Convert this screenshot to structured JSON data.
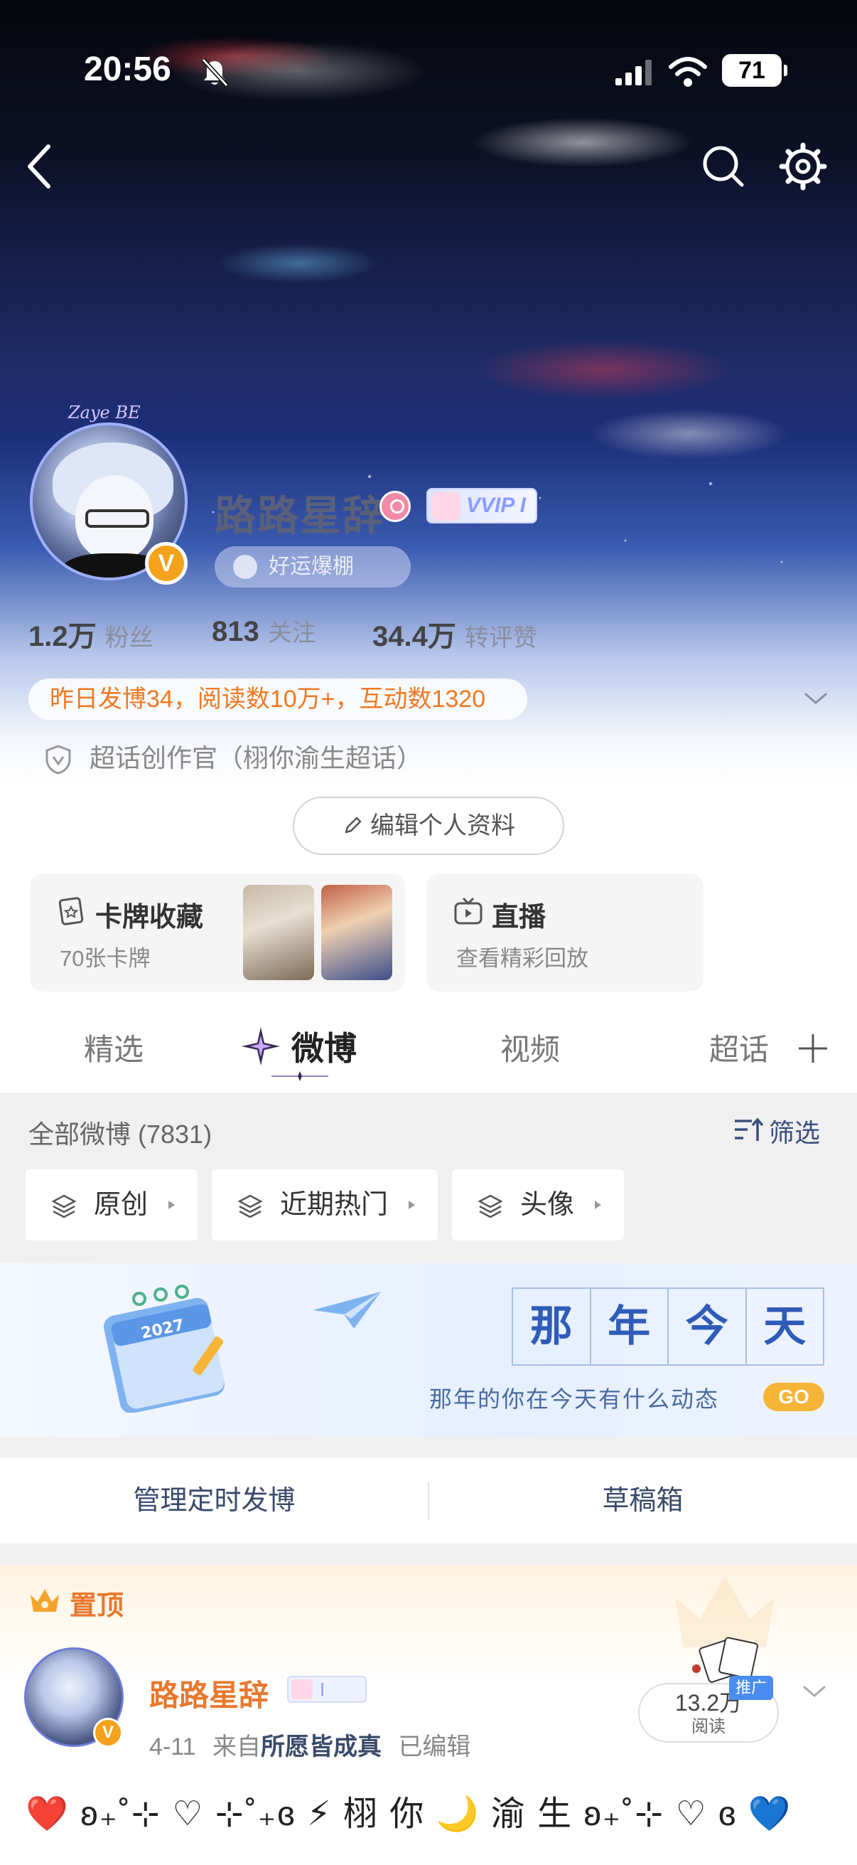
{
  "status_bar": {
    "time": "20:56",
    "battery": "71"
  },
  "profile": {
    "name": "路路星辞",
    "vip_badge": "VVIP I",
    "luck_pill": "好运爆棚",
    "avatar_deco_text": "Zaye BE",
    "verified_mark": "V",
    "stats": [
      {
        "value": "1.2万",
        "label": "粉丝"
      },
      {
        "value": "813",
        "label": "关注"
      },
      {
        "value": "34.4万",
        "label": "转评赞"
      }
    ],
    "activity_summary": "昨日发博34，阅读数10万+，互动数1320",
    "chaohua_title": "超话创作官（栩你渝生超话）",
    "edit_button": "编辑个人资料"
  },
  "cards": {
    "collection": {
      "title": "卡牌收藏",
      "subtitle": "70张卡牌"
    },
    "live": {
      "title": "直播",
      "subtitle": "查看精彩回放"
    }
  },
  "tabs": [
    {
      "label": "精选",
      "active": false
    },
    {
      "label": "微博",
      "active": true
    },
    {
      "label": "视频",
      "active": false
    },
    {
      "label": "超话",
      "active": false
    }
  ],
  "feed": {
    "all_label": "全部微博 (7831)",
    "filter_label": "筛选",
    "chips": [
      "原创",
      "近期热门",
      "头像"
    ]
  },
  "memory_banner": {
    "title_chars": [
      "那",
      "年",
      "今",
      "天"
    ],
    "subtitle": "那年的你在今天有什么动态",
    "go_label": "GO",
    "calendar_year": "2027"
  },
  "manage_row": {
    "scheduled": "管理定时发博",
    "drafts": "草稿箱"
  },
  "pinned_post": {
    "label": "置顶",
    "author": "路路星辞",
    "author_badge": "I",
    "date": "4-11",
    "from_prefix": "来自",
    "source": "所愿皆成真",
    "edited": "已编辑",
    "read_count": "13.2万",
    "read_label": "阅读",
    "promo_tag": "推广",
    "text": "❤️ ʚ₊˚⊹ ♡ ⊹˚₊ɞ ⚡ 栩 你 🌙 渝 生 ʚ₊˚⊹ ♡ ɞ 💙"
  },
  "colors": {
    "accent_orange": "#e8782e",
    "link_blue": "#3a4a6a",
    "go_yellow": "#f7b538",
    "verified": "#f4a21b"
  },
  "icons": [
    "bell-off-icon",
    "signal-icon",
    "wifi-icon",
    "back-arrow-icon",
    "search-icon",
    "gear-icon",
    "clover-icon",
    "shield-icon",
    "pencil-icon",
    "card-collect-icon",
    "tv-icon",
    "plus-icon",
    "filter-icon",
    "layers-icon",
    "crown-icon",
    "chevron-down-icon"
  ]
}
